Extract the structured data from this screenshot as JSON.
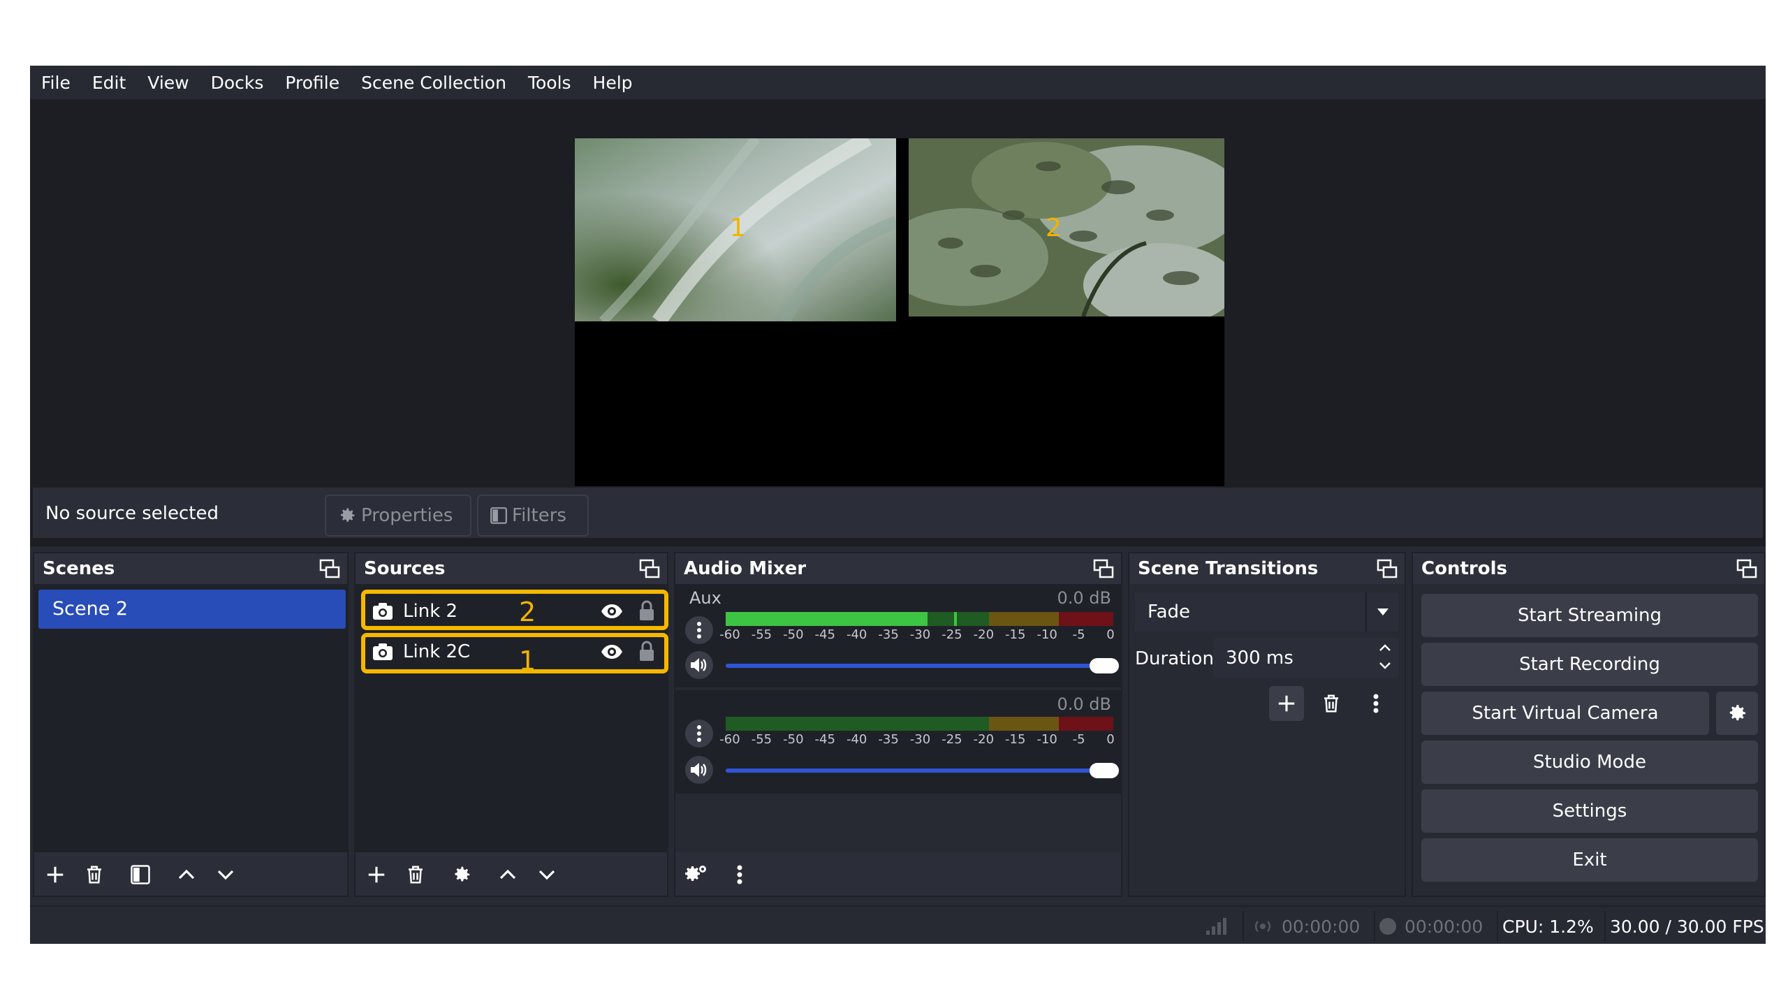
{
  "menu": [
    "File",
    "Edit",
    "View",
    "Docks",
    "Profile",
    "Scene Collection",
    "Tools",
    "Help"
  ],
  "preview": {
    "feed1_label": "1",
    "feed2_label": "2"
  },
  "source_toolbar": {
    "status": "No source selected",
    "properties_label": "Properties",
    "filters_label": "Filters"
  },
  "scenes": {
    "title": "Scenes",
    "items": [
      "Scene 2"
    ],
    "selected": "Scene 2"
  },
  "sources": {
    "title": "Sources",
    "items": [
      {
        "name": "Link 2",
        "annotation": "2",
        "visible": true,
        "locked": false
      },
      {
        "name": "Link 2C",
        "annotation": "1",
        "visible": true,
        "locked": false
      }
    ]
  },
  "audio_mixer": {
    "title": "Audio Mixer",
    "channels": [
      {
        "name": "Aux",
        "db": "0.0 dB",
        "level": 0.52
      },
      {
        "name": "",
        "db": "0.0 dB",
        "level": 0.0
      }
    ],
    "scale": [
      "-60",
      "-55",
      "-50",
      "-45",
      "-40",
      "-35",
      "-30",
      "-25",
      "-20",
      "-15",
      "-10",
      "-5",
      "0"
    ]
  },
  "scene_transitions": {
    "title": "Scene Transitions",
    "transition": "Fade",
    "duration_label": "Duration",
    "duration_value": "300 ms"
  },
  "controls": {
    "title": "Controls",
    "start_streaming": "Start Streaming",
    "start_recording": "Start Recording",
    "start_virtual_camera": "Start Virtual Camera",
    "studio_mode": "Studio Mode",
    "settings": "Settings",
    "exit": "Exit"
  },
  "status": {
    "stream_time": "00:00:00",
    "record_time": "00:00:00",
    "cpu": "CPU: 1.2%",
    "fps": "30.00 / 30.00 FPS"
  },
  "colors": {
    "accent": "#284cb8",
    "highlight": "#f5b800",
    "meter_green": "#3ec443",
    "meter_yellow": "#8a6f13",
    "meter_red": "#8b1520"
  }
}
